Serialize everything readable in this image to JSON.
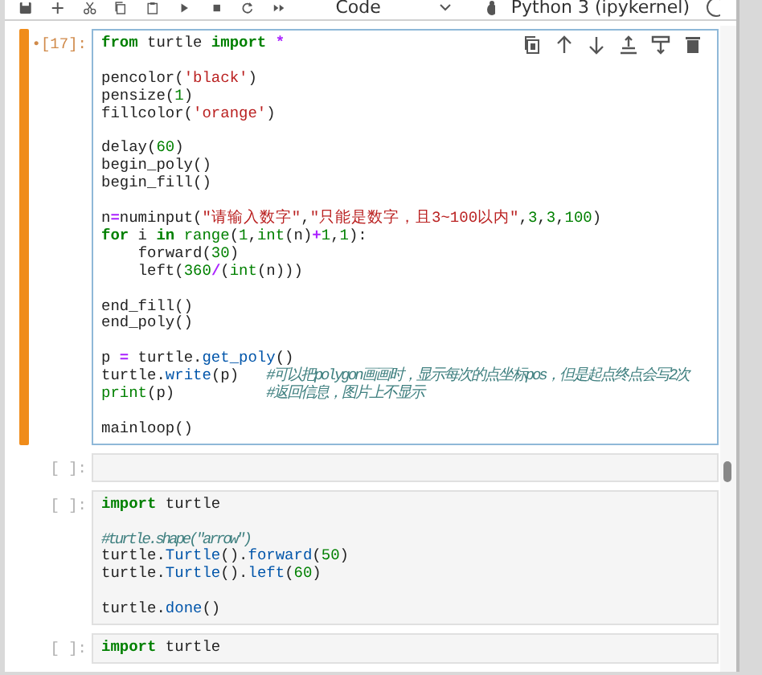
{
  "toolbar": {
    "buttons": [
      {
        "kind": "save"
      },
      {
        "kind": "add"
      },
      {
        "kind": "cut"
      },
      {
        "kind": "copy"
      },
      {
        "kind": "paste"
      },
      {
        "kind": "run"
      },
      {
        "kind": "stop"
      },
      {
        "kind": "restart"
      },
      {
        "kind": "run-all"
      }
    ],
    "cell_type": "Code",
    "kernel": "Python 3 (ipykernel)"
  },
  "cells": [
    {
      "prompt": "•[17]:",
      "selected": true,
      "toolbar": [
        {
          "kind": "duplicate"
        },
        {
          "kind": "up"
        },
        {
          "kind": "down"
        },
        {
          "kind": "insert-above"
        },
        {
          "kind": "insert-below"
        },
        {
          "kind": "delete"
        }
      ],
      "blocks": [
        [
          [
            {
              "text": "from",
              "kind": "kw"
            },
            {
              "text": " turtle ",
              "kind": "plain"
            },
            {
              "text": "import",
              "kind": "kw"
            },
            {
              "text": " *",
              "kind": "op"
            }
          ]
        ],
        [
          [
            {
              "text": "pencolor(",
              "kind": "plain"
            },
            {
              "text": "'black'",
              "kind": "str"
            },
            {
              "text": ")",
              "kind": "plain"
            }
          ],
          [
            {
              "text": "pensize(",
              "kind": "plain"
            },
            {
              "text": "1",
              "kind": "num"
            },
            {
              "text": ")",
              "kind": "plain"
            }
          ],
          [
            {
              "text": "fillcolor(",
              "kind": "plain"
            },
            {
              "text": "'orange'",
              "kind": "str"
            },
            {
              "text": ")",
              "kind": "plain"
            }
          ]
        ],
        [
          [
            {
              "text": "delay(",
              "kind": "plain"
            },
            {
              "text": "60",
              "kind": "num"
            },
            {
              "text": ")",
              "kind": "plain"
            }
          ],
          [
            {
              "text": "begin_poly()",
              "kind": "plain"
            }
          ],
          [
            {
              "text": "begin_fill()",
              "kind": "plain"
            }
          ]
        ],
        [
          [
            {
              "text": "n",
              "kind": "plain"
            },
            {
              "text": "=",
              "kind": "op"
            },
            {
              "text": "numinput(",
              "kind": "plain"
            },
            {
              "text": "\"请输入数字\"",
              "kind": "str"
            },
            {
              "text": ",",
              "kind": "plain"
            },
            {
              "text": "\"只能是数字，且3~100以内\"",
              "kind": "str"
            },
            {
              "text": ",",
              "kind": "plain"
            },
            {
              "text": "3",
              "kind": "num"
            },
            {
              "text": ",",
              "kind": "plain"
            },
            {
              "text": "3",
              "kind": "num"
            },
            {
              "text": ",",
              "kind": "plain"
            },
            {
              "text": "100",
              "kind": "num"
            },
            {
              "text": ")",
              "kind": "plain"
            }
          ],
          [
            {
              "text": "for",
              "kind": "kw"
            },
            {
              "text": " i ",
              "kind": "plain"
            },
            {
              "text": "in",
              "kind": "kw"
            },
            {
              "text": " range",
              "kind": "builtin"
            },
            {
              "text": "(",
              "kind": "plain"
            },
            {
              "text": "1",
              "kind": "num"
            },
            {
              "text": ",",
              "kind": "plain"
            },
            {
              "text": "int",
              "kind": "builtin"
            },
            {
              "text": "(n)",
              "kind": "plain"
            },
            {
              "text": "+",
              "kind": "op"
            },
            {
              "text": "1",
              "kind": "num"
            },
            {
              "text": ",",
              "kind": "plain"
            },
            {
              "text": "1",
              "kind": "num"
            },
            {
              "text": "):",
              "kind": "plain"
            }
          ],
          [
            {
              "text": "    forward(",
              "kind": "plain"
            },
            {
              "text": "30",
              "kind": "num"
            },
            {
              "text": ")",
              "kind": "plain"
            }
          ],
          [
            {
              "text": "    left(",
              "kind": "plain"
            },
            {
              "text": "360",
              "kind": "num"
            },
            {
              "text": "/",
              "kind": "op"
            },
            {
              "text": "(",
              "kind": "plain"
            },
            {
              "text": "int",
              "kind": "builtin"
            },
            {
              "text": "(n)))",
              "kind": "plain"
            }
          ]
        ],
        [
          [
            {
              "text": "end_fill()",
              "kind": "plain"
            }
          ],
          [
            {
              "text": "end_poly()",
              "kind": "plain"
            }
          ]
        ],
        [
          [
            {
              "text": "p ",
              "kind": "plain"
            },
            {
              "text": "=",
              "kind": "op"
            },
            {
              "text": " turtle.",
              "kind": "plain"
            },
            {
              "text": "get_poly",
              "kind": "attr"
            },
            {
              "text": "()",
              "kind": "plain"
            }
          ],
          [
            {
              "text": "turtle.",
              "kind": "plain"
            },
            {
              "text": "write",
              "kind": "attr"
            },
            {
              "text": "(p)   ",
              "kind": "plain"
            },
            {
              "text": "#可以把polygon画画时，显示每次的点坐标pos，但是起点终点会写2次",
              "kind": "comment"
            }
          ],
          [
            {
              "text": "print",
              "kind": "builtin"
            },
            {
              "text": "(p)          ",
              "kind": "plain"
            },
            {
              "text": "#返回信息，图片上不显示",
              "kind": "comment"
            }
          ]
        ],
        [
          [
            {
              "text": "mainloop()",
              "kind": "plain"
            }
          ]
        ]
      ]
    },
    {
      "prompt": "[ ]:",
      "selected": false
    },
    {
      "prompt": "[ ]:",
      "selected": false,
      "blocks": [
        [
          [
            {
              "text": "import",
              "kind": "kw"
            },
            {
              "text": " turtle",
              "kind": "plain"
            }
          ]
        ],
        [
          [
            {
              "text": "#turtle.shape(\"arrow\")",
              "kind": "comment"
            }
          ],
          [
            {
              "text": "turtle.",
              "kind": "plain"
            },
            {
              "text": "Turtle",
              "kind": "attr"
            },
            {
              "text": "().",
              "kind": "plain"
            },
            {
              "text": "forward",
              "kind": "attr"
            },
            {
              "text": "(",
              "kind": "plain"
            },
            {
              "text": "50",
              "kind": "num"
            },
            {
              "text": ")",
              "kind": "plain"
            }
          ],
          [
            {
              "text": "turtle.",
              "kind": "plain"
            },
            {
              "text": "Turtle",
              "kind": "attr"
            },
            {
              "text": "().",
              "kind": "plain"
            },
            {
              "text": "left",
              "kind": "attr"
            },
            {
              "text": "(",
              "kind": "plain"
            },
            {
              "text": "60",
              "kind": "num"
            },
            {
              "text": ")",
              "kind": "plain"
            }
          ]
        ],
        [
          [
            {
              "text": "turtle.",
              "kind": "plain"
            },
            {
              "text": "done",
              "kind": "attr"
            },
            {
              "text": "()",
              "kind": "plain"
            }
          ]
        ]
      ]
    },
    {
      "prompt": "[ ]:",
      "selected": false,
      "blocks": [
        [
          [
            {
              "text": "import",
              "kind": "kw"
            },
            {
              "text": " turtle",
              "kind": "plain"
            }
          ]
        ]
      ]
    }
  ]
}
